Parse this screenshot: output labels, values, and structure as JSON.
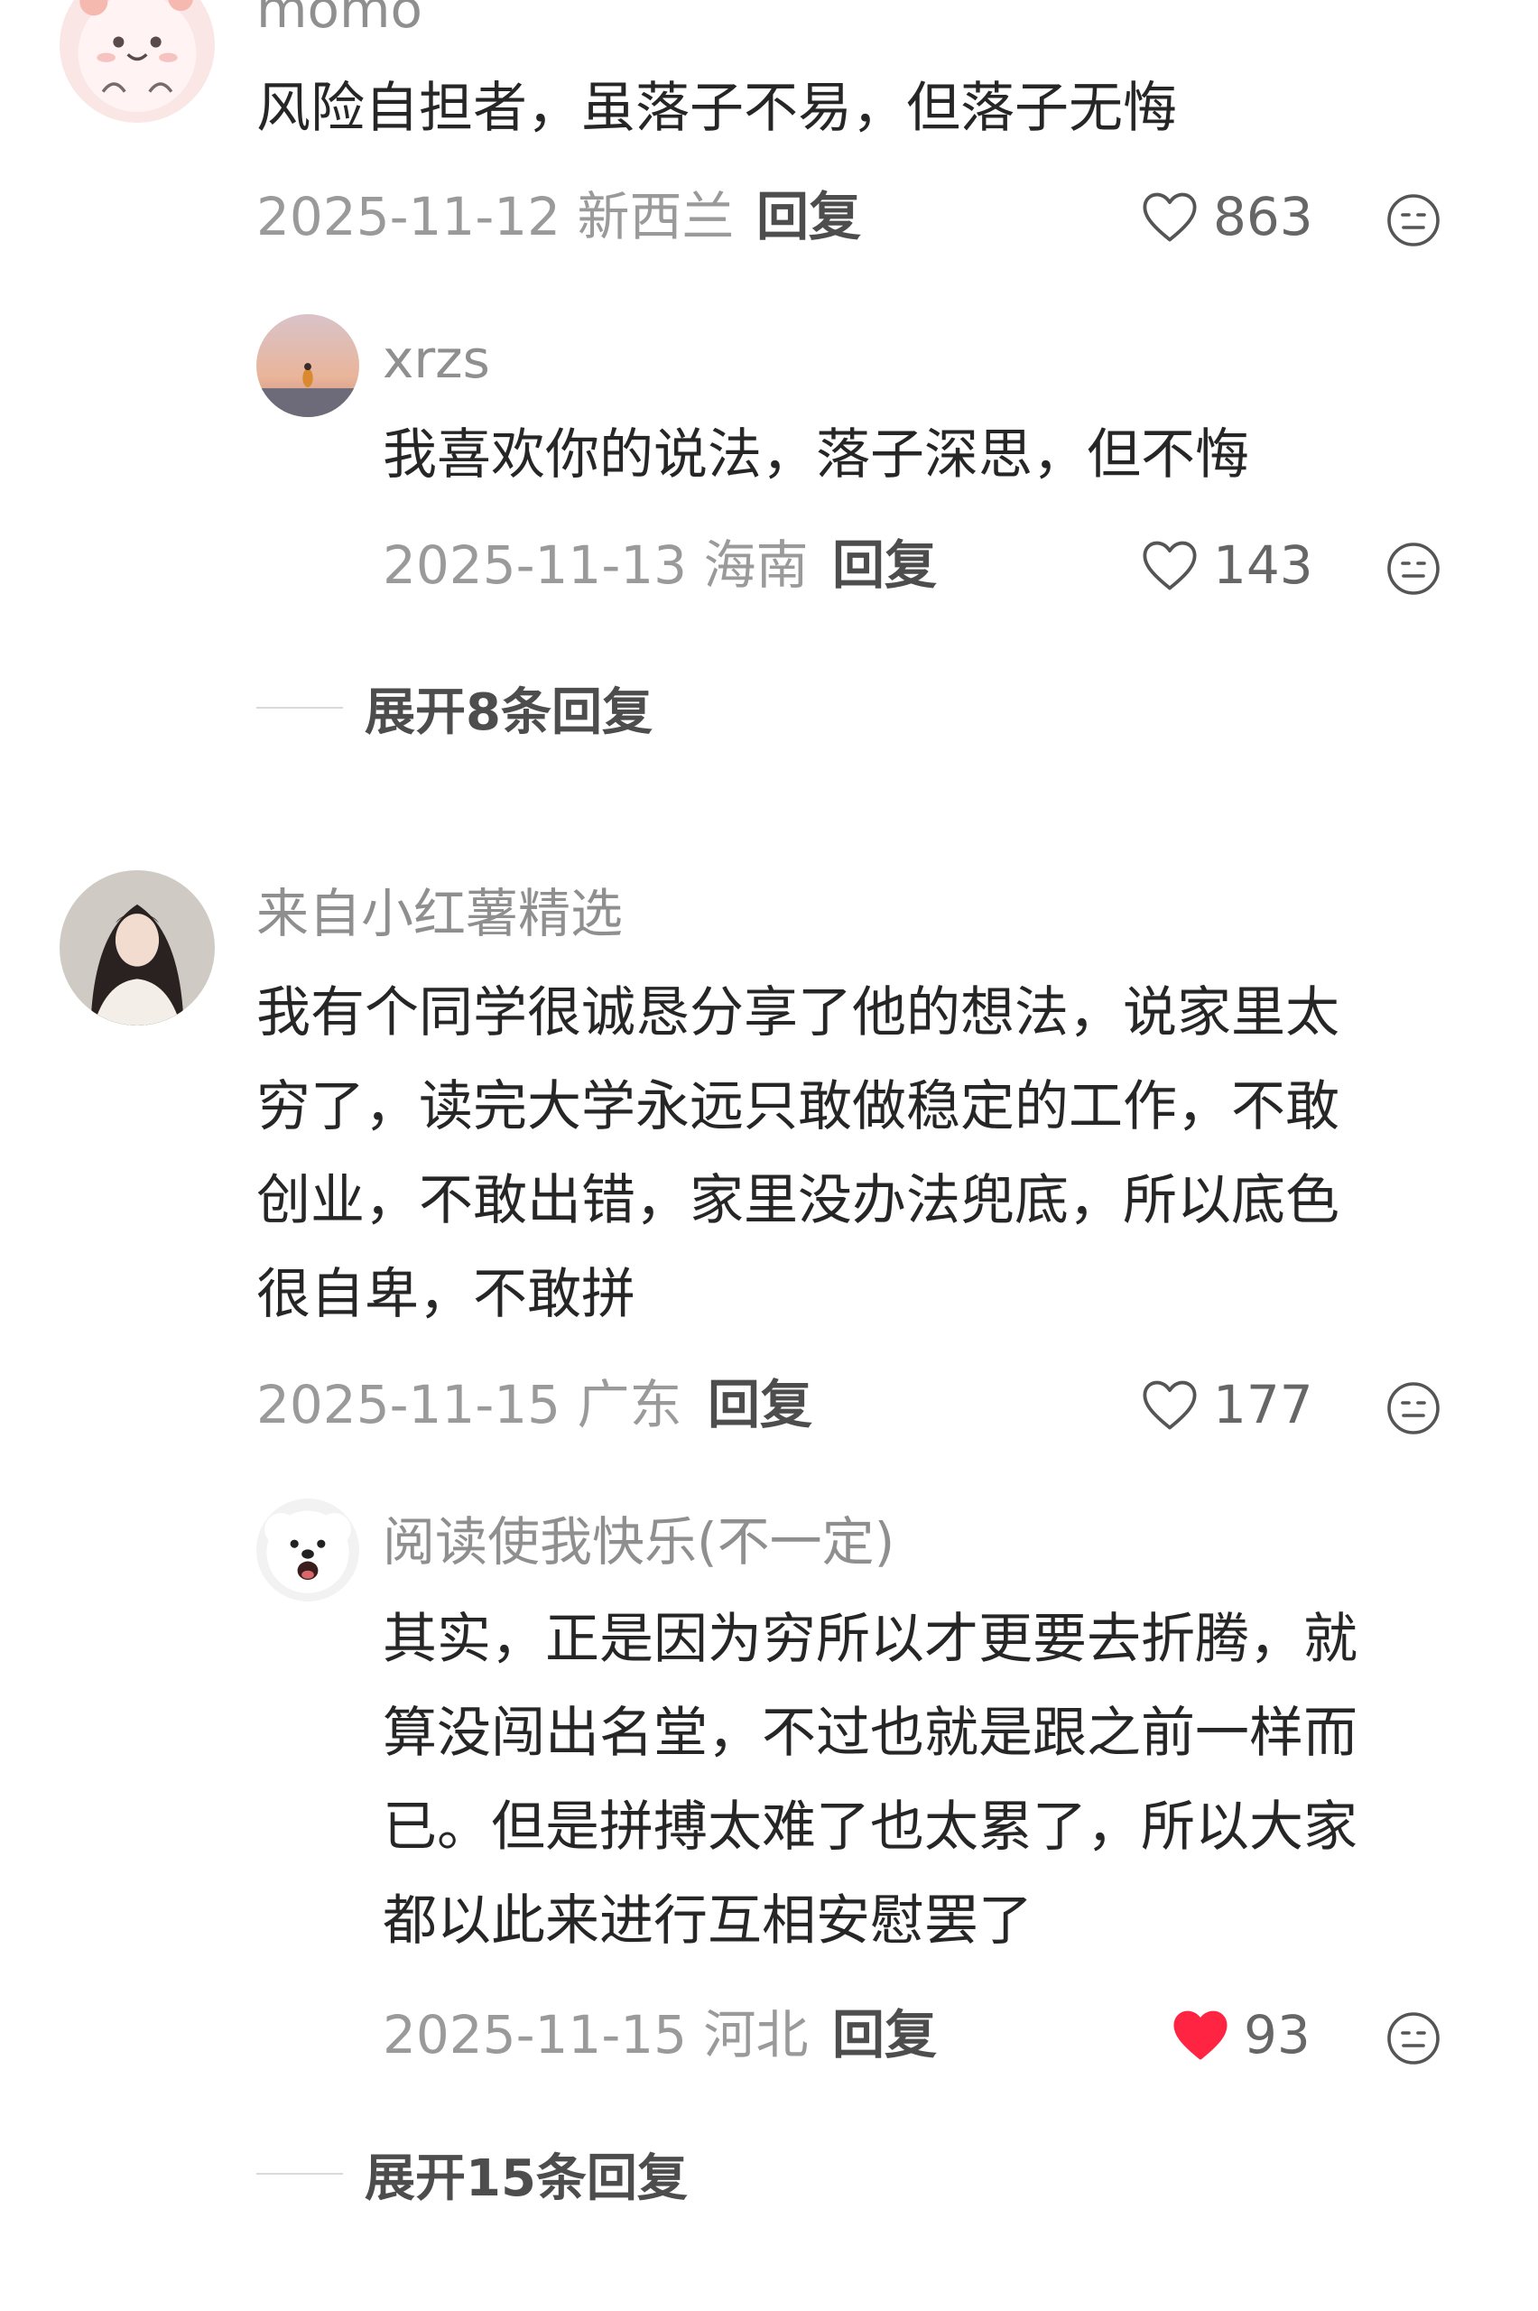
{
  "comments": [
    {
      "username": "momo",
      "text_lines": [
        "风险自担者，虽落子不易，但落子无悔"
      ],
      "date": "2025-11-12",
      "location": "新西兰",
      "reply_label": "回复",
      "likes": "863",
      "liked": false,
      "replies": [
        {
          "username": "xrzs",
          "text_lines": [
            "我喜欢你的说法，落子深思，但不悔"
          ],
          "date": "2025-11-13",
          "location": "海南",
          "reply_label": "回复",
          "likes": "143",
          "liked": false
        }
      ],
      "expand_label": "展开8条回复"
    },
    {
      "username": "来自小红薯精选",
      "text_lines": [
        "我有个同学很诚恳分享了他的想法，说家里太",
        "穷了，读完大学永远只敢做稳定的工作，不敢",
        "创业，不敢出错，家里没办法兜底，所以底色",
        "很自卑，不敢拼"
      ],
      "date": "2025-11-15",
      "location": "广东",
      "reply_label": "回复",
      "likes": "177",
      "liked": false,
      "replies": [
        {
          "username": "阅读使我快乐(不一定)",
          "text_lines": [
            "其实，正是因为穷所以才更要去折腾，就",
            "算没闯出名堂，不过也就是跟之前一样而",
            "已。但是拼搏太难了也太累了，所以大家",
            "都以此来进行互相安慰罢了"
          ],
          "date": "2025-11-15",
          "location": "河北",
          "reply_label": "回复",
          "likes": "93",
          "liked": true
        }
      ],
      "expand_label": "展开15条回复"
    }
  ],
  "colors": {
    "liked_heart": "#ff2442",
    "username": "#8f8f8f",
    "meta": "#9a9a9a"
  },
  "icons": [
    "heart-icon",
    "emoji-icon"
  ]
}
